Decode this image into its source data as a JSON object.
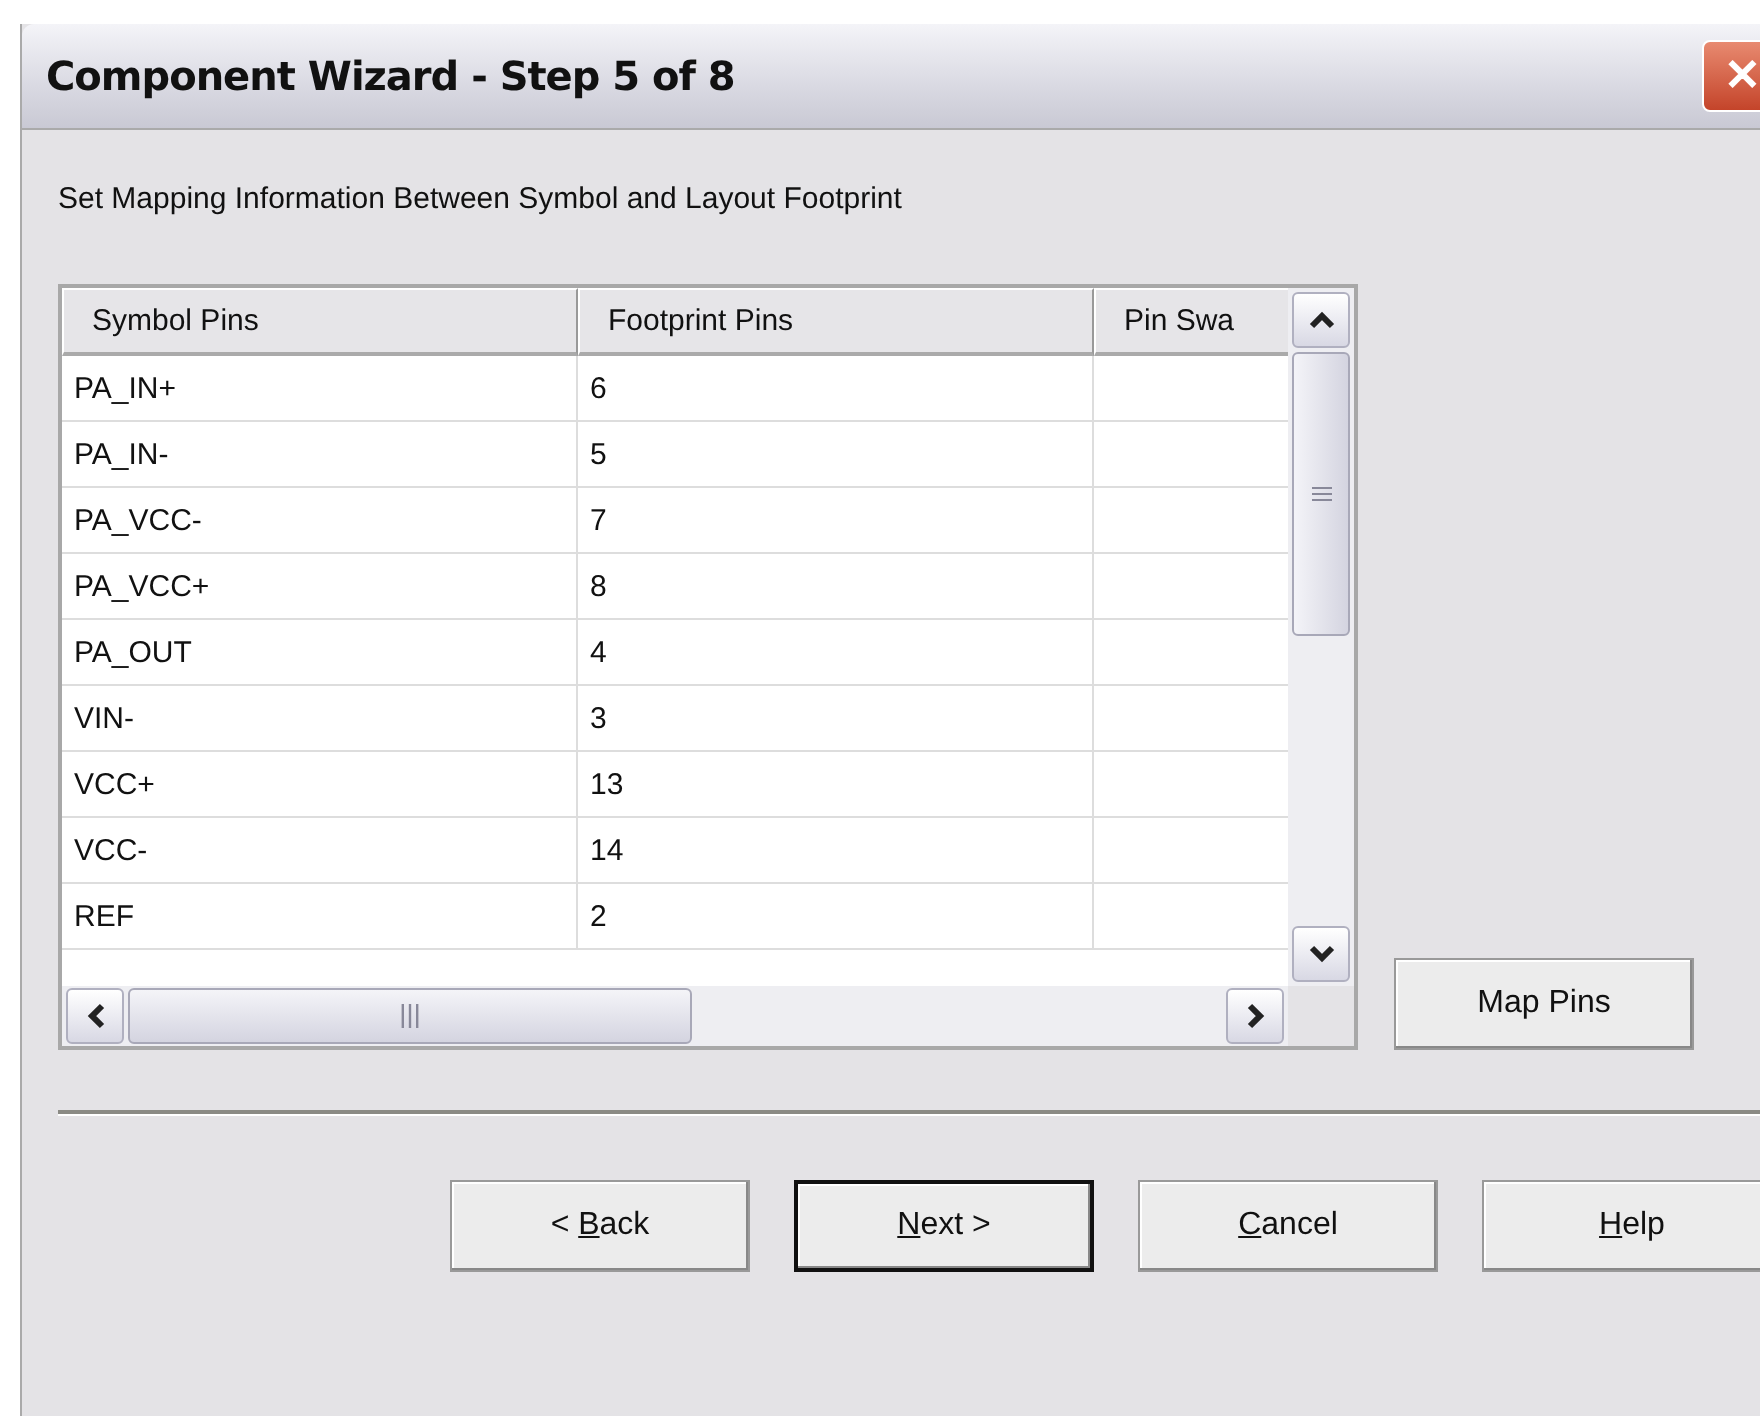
{
  "window": {
    "title": "Component Wizard - Step 5 of 8",
    "close_glyph": "✕"
  },
  "instruction": "Set Mapping Information Between Symbol and Layout Footprint",
  "table": {
    "columns": [
      "Symbol Pins",
      "Footprint Pins",
      "Pin Swa"
    ],
    "rows": [
      [
        "PA_IN+",
        "6",
        ""
      ],
      [
        "PA_IN-",
        "5",
        ""
      ],
      [
        "PA_VCC-",
        "7",
        ""
      ],
      [
        "PA_VCC+",
        "8",
        ""
      ],
      [
        "PA_OUT",
        "4",
        ""
      ],
      [
        "VIN-",
        "3",
        ""
      ],
      [
        "VCC+",
        "13",
        ""
      ],
      [
        "VCC-",
        "14",
        ""
      ],
      [
        "REF",
        "2",
        ""
      ]
    ]
  },
  "map_button": "Map Pins",
  "buttons": [
    {
      "before": "< ",
      "key": "B",
      "after": "ack",
      "default": false
    },
    {
      "key": "N",
      "after": "ext >",
      "default": true
    },
    {
      "key": "C",
      "after": "ancel",
      "default": false
    },
    {
      "key": "H",
      "after": "elp",
      "default": false
    }
  ]
}
